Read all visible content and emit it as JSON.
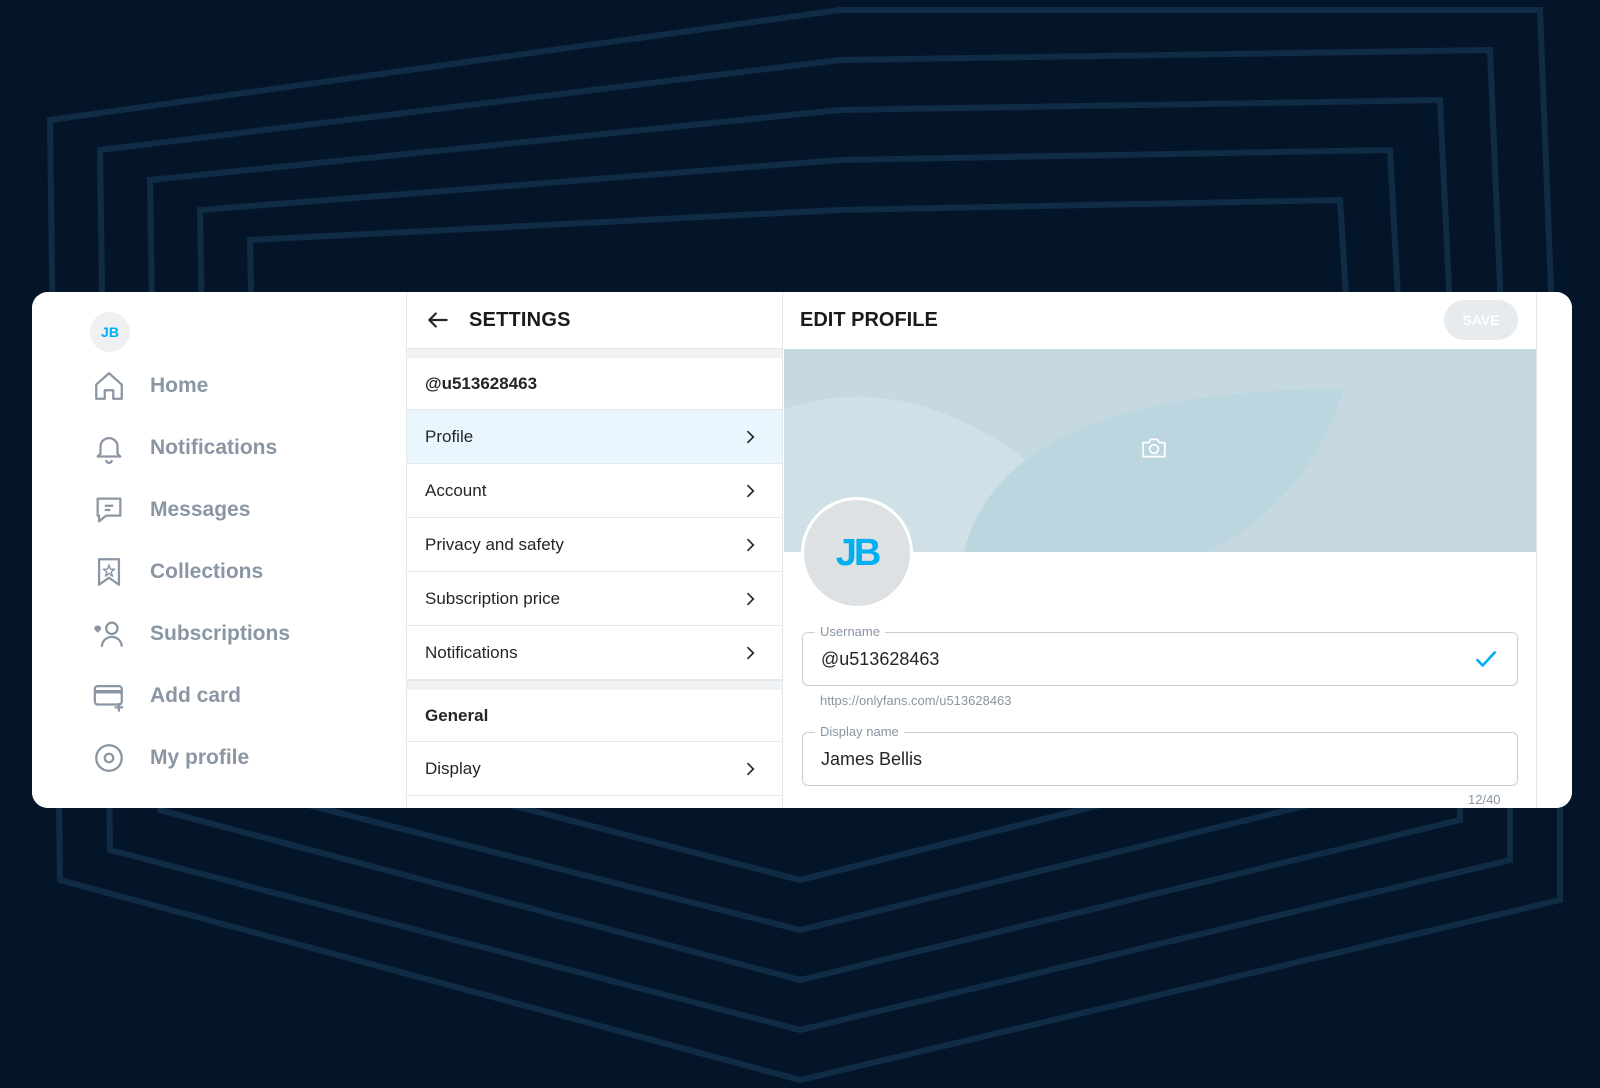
{
  "nav": {
    "avatar_initials": "JB",
    "items": [
      {
        "label": "Home",
        "icon": "home-icon"
      },
      {
        "label": "Notifications",
        "icon": "bell-icon"
      },
      {
        "label": "Messages",
        "icon": "message-icon"
      },
      {
        "label": "Collections",
        "icon": "bookmark-star-icon"
      },
      {
        "label": "Subscriptions",
        "icon": "user-heart-icon"
      },
      {
        "label": "Add card",
        "icon": "credit-card-add-icon"
      },
      {
        "label": "My profile",
        "icon": "profile-circle-icon"
      }
    ]
  },
  "settings": {
    "title": "SETTINGS",
    "username_heading": "@u513628463",
    "menu": [
      "Profile",
      "Account",
      "Privacy and safety",
      "Subscription price",
      "Notifications"
    ],
    "active_item": "Profile",
    "general_heading": "General",
    "general_menu": [
      "Display"
    ]
  },
  "edit_profile": {
    "title": "EDIT PROFILE",
    "save_label": "SAVE",
    "avatar_initials": "JB",
    "username": {
      "label": "Username",
      "value": "@u513628463",
      "url": "https://onlyfans.com/u513628463"
    },
    "display_name": {
      "label": "Display name",
      "value": "James Bellis",
      "counter": "12/40"
    }
  },
  "colors": {
    "accent": "#00aff0",
    "muted": "#8a96a3",
    "background": "#04152a",
    "active_row": "#e9f6fe"
  }
}
